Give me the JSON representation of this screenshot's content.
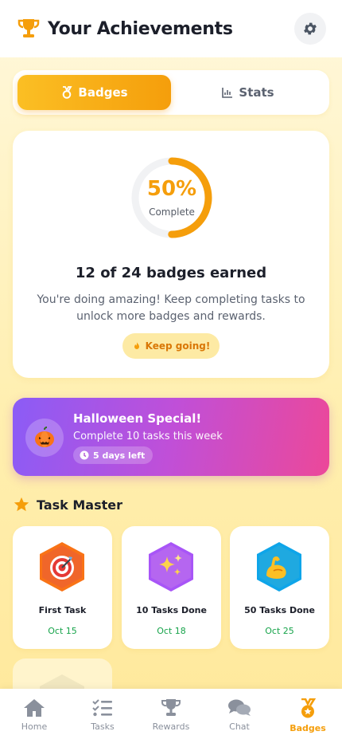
{
  "header": {
    "title": "Your Achievements",
    "icon": "trophy-icon",
    "settings_icon": "gear-icon"
  },
  "tabs": [
    {
      "label": "Badges",
      "icon": "medal-icon",
      "active": true
    },
    {
      "label": "Stats",
      "icon": "bar-chart-icon",
      "active": false
    }
  ],
  "progress": {
    "percent_label": "50%",
    "percent": 50,
    "sublabel": "Complete",
    "earned_text": "12 of 24 badges earned",
    "description": "You're doing amazing! Keep completing tasks to unlock more badges and rewards.",
    "button_label": "Keep going!",
    "button_icon": "fire-icon"
  },
  "event": {
    "title": "Halloween Special!",
    "subtitle": "Complete 10 tasks this week",
    "pill": "5 days left",
    "icon": "pumpkin-icon",
    "pill_icon": "clock-icon"
  },
  "section": {
    "title": "Task Master",
    "icon": "star-icon"
  },
  "badges": [
    {
      "name": "First Task",
      "date": "Oct 15",
      "icon": "target-icon",
      "color": "#f97316"
    },
    {
      "name": "10 Tasks Done",
      "date": "Oct 18",
      "icon": "sparkles-icon",
      "color": "#a855f7"
    },
    {
      "name": "50 Tasks Done",
      "date": "Oct 25",
      "icon": "flexed-biceps-icon",
      "color": "#0ea5e9"
    }
  ],
  "nav": [
    {
      "label": "Home",
      "icon": "home-icon",
      "active": false
    },
    {
      "label": "Tasks",
      "icon": "checklist-icon",
      "active": false
    },
    {
      "label": "Rewards",
      "icon": "trophy-icon",
      "active": false
    },
    {
      "label": "Chat",
      "icon": "chat-icon",
      "active": false
    },
    {
      "label": "Badges",
      "icon": "medal-icon",
      "active": true
    }
  ],
  "colors": {
    "accent": "#f59e0b",
    "success": "#16a34a",
    "event_start": "#8b5cf6",
    "event_end": "#ec4899"
  }
}
